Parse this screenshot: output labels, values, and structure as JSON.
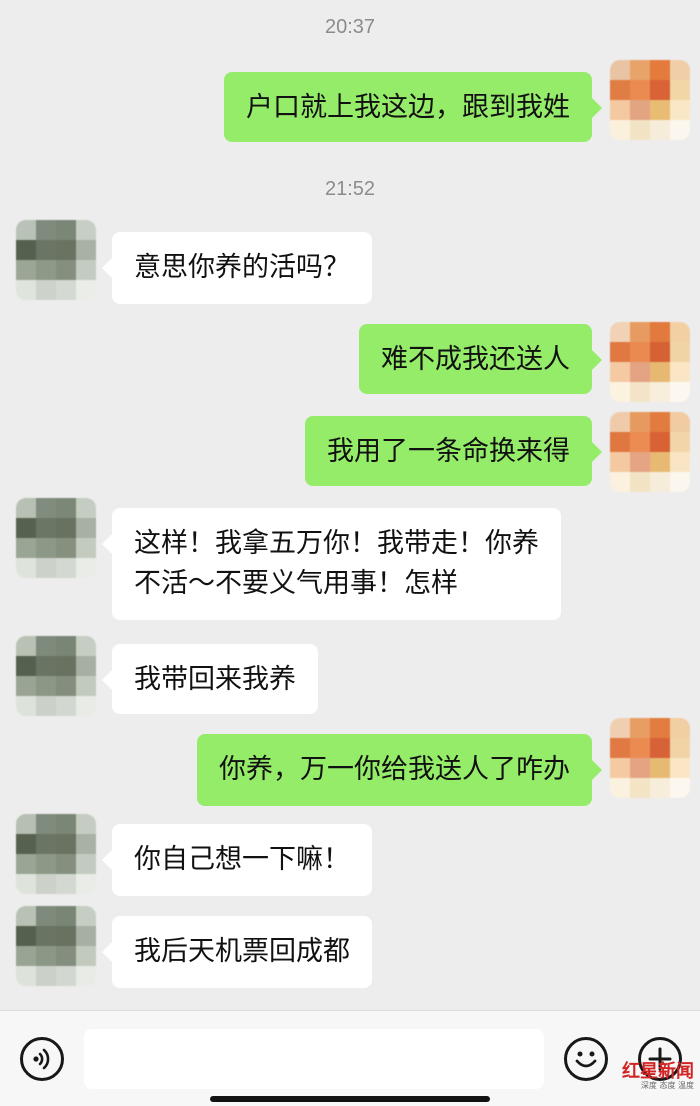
{
  "timestamps": [
    "20:37",
    "21:52"
  ],
  "messages": [
    {
      "side": "right",
      "text": "户口就上我这边，跟到我姓"
    },
    {
      "side": "left",
      "text": "意思你养的活吗？"
    },
    {
      "side": "right",
      "text": "难不成我还送人"
    },
    {
      "side": "right",
      "text": "我用了一条命换来得"
    },
    {
      "side": "left",
      "text": "这样！我拿五万你！我带走！你养\n不活～不要义气用事！怎样"
    },
    {
      "side": "left",
      "text": "我带回来我养"
    },
    {
      "side": "right",
      "text": "你养，万一你给我送人了咋办"
    },
    {
      "side": "left",
      "text": "你自己想一下嘛！"
    },
    {
      "side": "left",
      "text": "我后天机票回成都"
    }
  ],
  "input_bar": {
    "voice_icon": "voice-icon",
    "emoji_icon": "emoji-icon",
    "plus_icon": "plus-icon",
    "text": ""
  },
  "watermark": {
    "logo_text": "红星新闻",
    "tagline": "深度 态度 温度"
  },
  "colors": {
    "background": "#ededed",
    "sent_bubble": "#95ec69",
    "received_bubble": "#ffffff",
    "watermark": "#d32424"
  }
}
